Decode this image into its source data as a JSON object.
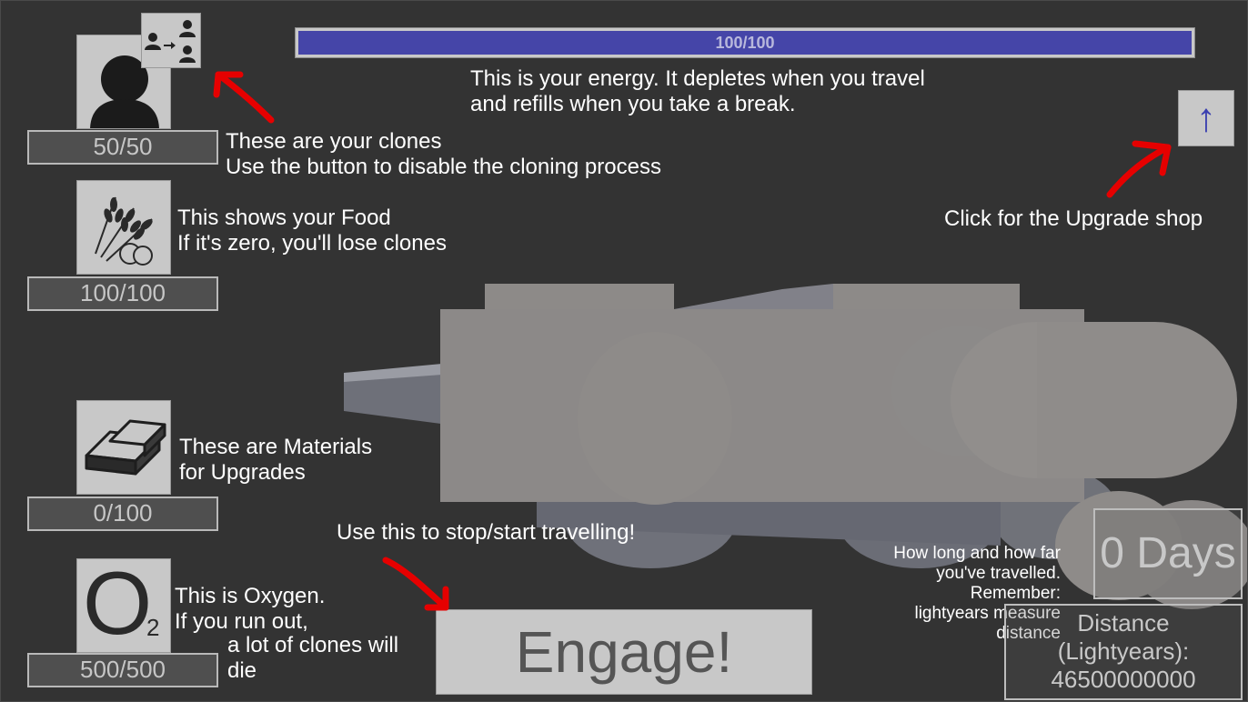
{
  "resources": {
    "clones": {
      "value": "50/50",
      "note": "These are your clones\nUse the button to disable the cloning process"
    },
    "food": {
      "value": "100/100",
      "note": "This shows your Food\nIf it's zero, you'll lose clones"
    },
    "materials": {
      "value": "0/100",
      "note": "These are Materials\nfor Upgrades"
    },
    "oxygen": {
      "value": "500/500",
      "symbol": "O",
      "subscript": "2",
      "note_a": "This is Oxygen.\nIf you run out,",
      "note_b": "a lot of clones will\ndie"
    }
  },
  "energy": {
    "label": "100/100",
    "level": 1.0,
    "fill_color": "#4545a8",
    "note": "This is your energy. It depletes when you travel\nand refills when you take a break."
  },
  "upgrade": {
    "arrow": "↑",
    "note": "Click for the Upgrade shop"
  },
  "engage": {
    "label": "Engage!",
    "note": "Use this to stop/start travelling!"
  },
  "travel": {
    "days": "0 Days",
    "distance_label": "Distance\n(Lightyears):",
    "distance_value": "46500000000",
    "note": "How long and how far\nyou've travelled.\nRemember:\nlightyears measure\ndistance"
  },
  "annotation_color": "#e60000",
  "icons": [
    "person-icon",
    "clone-toggle-icon",
    "wheat-icon",
    "ingots-icon",
    "oxygen-icon",
    "arrow-up-icon"
  ]
}
